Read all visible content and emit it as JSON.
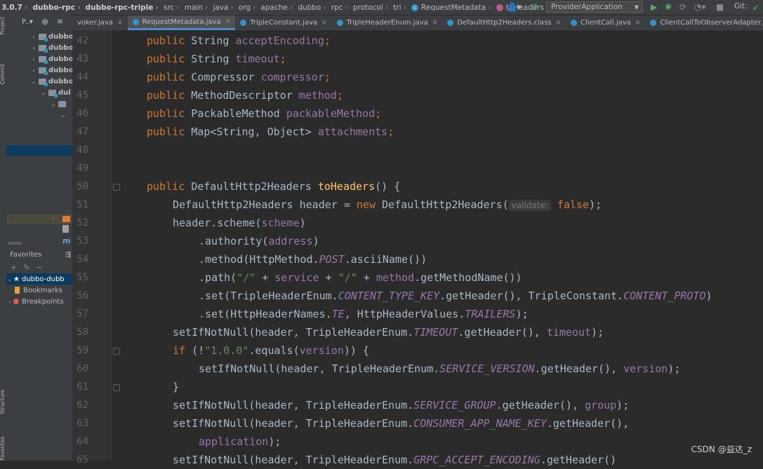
{
  "breadcrumbs": [
    "3.0.7",
    "dubbo-rpc",
    "dubbo-rpc-triple",
    "src",
    "main",
    "java",
    "org",
    "apache",
    "dubbo",
    "rpc",
    "protocol",
    "tri",
    "RequestMetadata",
    "toHeaders"
  ],
  "run_config": "ProviderApplication",
  "vcs_label": "Git:",
  "project_panel": {
    "title": "P..▾",
    "tree_items": [
      "dubbo",
      "dubbo",
      "dubbo",
      "dubbo",
      "dubbo",
      "dul"
    ],
    "favorites_title": "Favorites",
    "favorites_items": [
      "dubbo-dubb",
      "Bookmarks",
      "Breakpoints"
    ]
  },
  "toolstrip_labels": [
    "Project",
    "Commit",
    "Structure",
    "Favorites"
  ],
  "tabs": [
    {
      "label": "voker.java",
      "active": false
    },
    {
      "label": "RequestMetadata.java",
      "active": true
    },
    {
      "label": "TripleConstant.java",
      "active": false
    },
    {
      "label": "TripleHeaderEnum.java",
      "active": false
    },
    {
      "label": "DefaultHttp2Headers.class",
      "active": false
    },
    {
      "label": "ClientCall.java",
      "active": false
    },
    {
      "label": "ClientCallToObserverAdapter.java",
      "active": false
    }
  ],
  "line_numbers": [
    "42",
    "43",
    "44",
    "45",
    "46",
    "47",
    "48",
    "49",
    "50",
    "51",
    "52",
    "53",
    "54",
    "55",
    "56",
    "57",
    "58",
    "59",
    "60",
    "61",
    "62",
    "63",
    "64",
    "65"
  ],
  "code": {
    "l42": [
      "public",
      "String",
      "acceptEncoding"
    ],
    "l43": [
      "public",
      "String",
      "timeout"
    ],
    "l44": [
      "public",
      "Compressor",
      "compressor"
    ],
    "l45": [
      "public",
      "MethodDescriptor",
      "method"
    ],
    "l46": [
      "public",
      "PackableMethod",
      "packableMethod"
    ],
    "l47": [
      "public",
      "Map<String, Object>",
      "attachments"
    ],
    "l50": [
      "public",
      "DefaultHttp2Headers",
      "toHeaders",
      "() {"
    ],
    "l51": [
      "DefaultHttp2Headers header = ",
      "new",
      " DefaultHttp2Headers(",
      "validate:",
      "false",
      ");"
    ],
    "l52": [
      "header.scheme(",
      "scheme",
      ")"
    ],
    "l53": [
      ".authority(",
      "address",
      ")"
    ],
    "l54": [
      ".method(HttpMethod.",
      "POST",
      ".asciiName())"
    ],
    "l55": [
      ".path(",
      "\"/\"",
      " + ",
      "service",
      " + ",
      "\"/\"",
      " + ",
      "method",
      ".getMethodName())"
    ],
    "l56": [
      ".set(TripleHeaderEnum.",
      "CONTENT_TYPE_KEY",
      ".getHeader(), TripleConstant.",
      "CONTENT_PROTO",
      ")"
    ],
    "l57": [
      ".set(HttpHeaderNames.",
      "TE",
      ", HttpHeaderValues.",
      "TRAILERS",
      ");"
    ],
    "l58": [
      "setIfNotNull(header, TripleHeaderEnum.",
      "TIMEOUT",
      ".getHeader(), ",
      "timeout",
      ");"
    ],
    "l59": [
      "if",
      " (!",
      "\"1.0.0\"",
      ".equals(",
      "version",
      ")) {"
    ],
    "l60": [
      "setIfNotNull(header, TripleHeaderEnum.",
      "SERVICE_VERSION",
      ".getHeader(), ",
      "version",
      ");"
    ],
    "l61": [
      "}"
    ],
    "l62": [
      "setIfNotNull(header, TripleHeaderEnum.",
      "SERVICE_GROUP",
      ".getHeader(), ",
      "group",
      ");"
    ],
    "l63": [
      "setIfNotNull(header, TripleHeaderEnum.",
      "CONSUMER_APP_NAME_KEY",
      ".getHeader(),"
    ],
    "l64": [
      "application",
      ");"
    ],
    "l65": [
      "setIfNotNull(header, TripleHeaderEnum.",
      "GRPC_ACCEPT_ENCODING",
      ".getHeader()"
    ]
  },
  "watermark": "CSDN @益达_z",
  "colors": {
    "keyword": "#cc7832",
    "field": "#9876aa",
    "method_decl": "#ffc66d",
    "string": "#6a8759",
    "text": "#a9b7c6"
  }
}
